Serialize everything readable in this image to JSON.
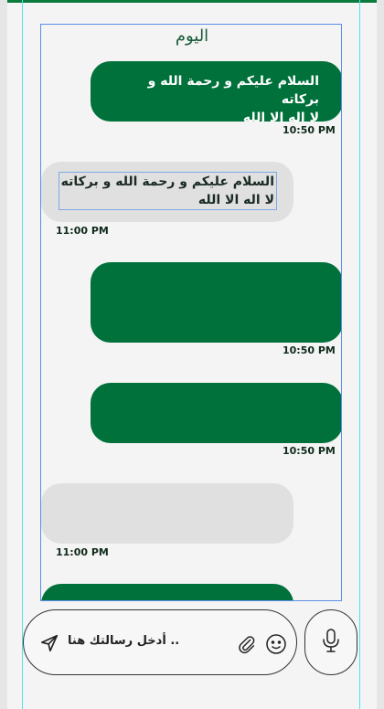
{
  "chat": {
    "day_label": "اليوم",
    "messages": [
      {
        "type": "outgoing",
        "lines": [
          "السلام عليكم و رحمة الله و بركاته",
          "لا اله الا الله"
        ],
        "time": "10:50 PM"
      },
      {
        "type": "incoming",
        "lines": [
          "السلام عليكم و رحمة الله و بركاته",
          "لا اله الا الله"
        ],
        "time": "11:00 PM"
      },
      {
        "type": "outgoing",
        "lines": [],
        "time": "10:50 PM"
      },
      {
        "type": "outgoing",
        "lines": [],
        "time": "10:50 PM"
      },
      {
        "type": "incoming",
        "lines": [],
        "time": "11:00 PM"
      },
      {
        "type": "outgoing",
        "lines": [],
        "time": ""
      }
    ]
  },
  "composer": {
    "placeholder": ".. أدخل رسالتك هنا",
    "icons": [
      "send-icon",
      "attachment-icon",
      "emoji-icon",
      "microphone-icon"
    ]
  },
  "colors": {
    "outgoing_bubble": "#00713b",
    "incoming_bubble": "#e0e0e0",
    "accent": "#0a7a3d"
  }
}
